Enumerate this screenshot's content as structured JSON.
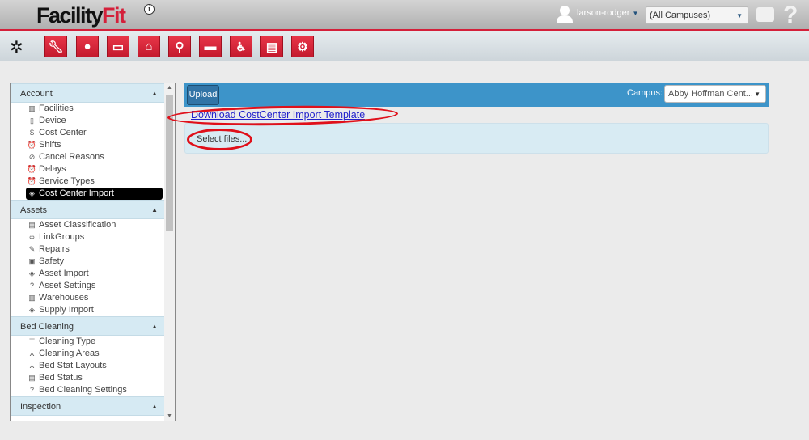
{
  "header": {
    "logo_main": "Facility",
    "logo_accent": "Fit",
    "info_icon": "info-icon",
    "username": "larson-rodger",
    "campus_select": "(All Campuses)"
  },
  "toolbar": {
    "buttons": [
      "wrench-icon",
      "user-icon",
      "monitor-icon",
      "home-plus-icon",
      "search-icon",
      "bed-icon",
      "wheelchair-icon",
      "document-icon",
      "gears-icon"
    ]
  },
  "sidebar": {
    "sections": [
      {
        "title": "Account",
        "items": [
          {
            "label": "Facilities",
            "icon": "▥"
          },
          {
            "label": "Device",
            "icon": "▯"
          },
          {
            "label": "Cost Center",
            "icon": "$"
          },
          {
            "label": "Shifts",
            "icon": "⏰"
          },
          {
            "label": "Cancel Reasons",
            "icon": "⊘"
          },
          {
            "label": "Delays",
            "icon": "⏰"
          },
          {
            "label": "Service Types",
            "icon": "⏰"
          },
          {
            "label": "Cost Center Import",
            "icon": "◈",
            "active": true
          }
        ]
      },
      {
        "title": "Assets",
        "items": [
          {
            "label": "Asset Classification",
            "icon": "▤"
          },
          {
            "label": "LinkGroups",
            "icon": "∞"
          },
          {
            "label": "Repairs",
            "icon": "✎"
          },
          {
            "label": "Safety",
            "icon": "▣"
          },
          {
            "label": "Asset Import",
            "icon": "◈"
          },
          {
            "label": "Asset Settings",
            "icon": "?"
          },
          {
            "label": "Warehouses",
            "icon": "▥"
          },
          {
            "label": "Supply Import",
            "icon": "◈"
          }
        ]
      },
      {
        "title": "Bed Cleaning",
        "items": [
          {
            "label": "Cleaning Type",
            "icon": "⊤"
          },
          {
            "label": "Cleaning Areas",
            "icon": "⅄"
          },
          {
            "label": "Bed Stat Layouts",
            "icon": "⅄"
          },
          {
            "label": "Bed Status",
            "icon": "▤"
          },
          {
            "label": "Bed Cleaning Settings",
            "icon": "?"
          }
        ]
      },
      {
        "title": "Inspection",
        "items": []
      }
    ]
  },
  "main": {
    "upload_label": "Upload",
    "campus_label": "Campus:",
    "campus_value": "Abby Hoffman Cent...",
    "download_link": "Download CostCenter Import Template",
    "select_files": "Select files..."
  },
  "colors": {
    "accent_red": "#d4203a",
    "panel_blue": "#3d94c9",
    "highlight": "#e0101a"
  }
}
